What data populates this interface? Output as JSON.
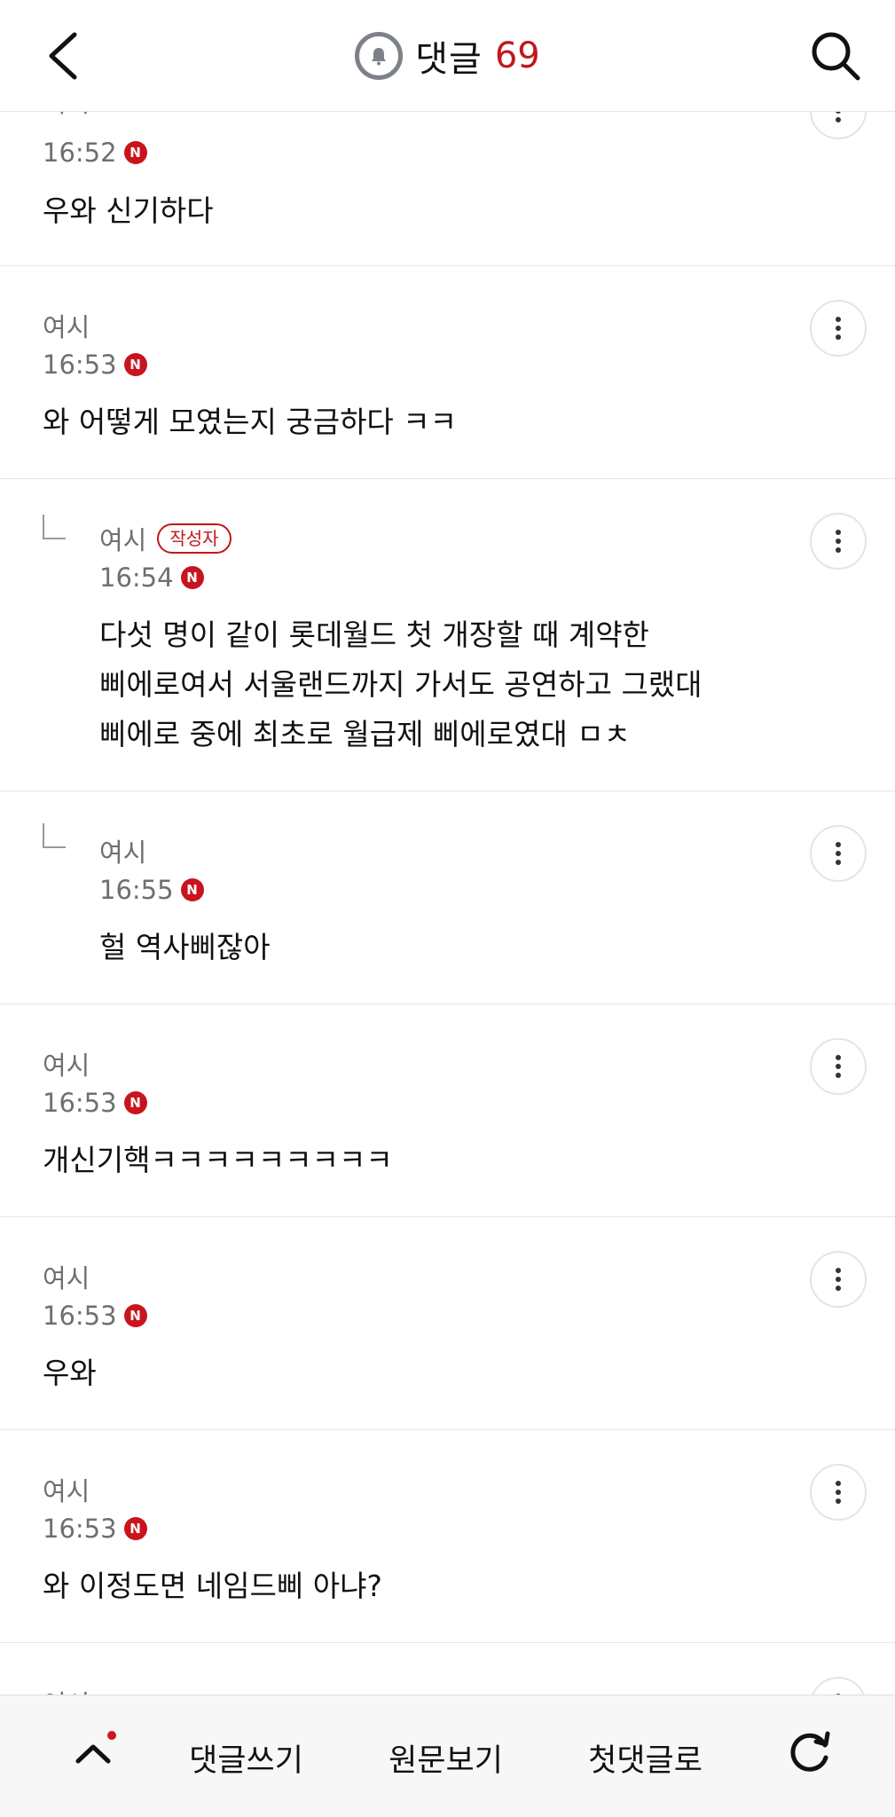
{
  "header": {
    "title": "댓글",
    "count": "69"
  },
  "comments": [
    {
      "author": "여시",
      "time": "16:52",
      "new_badge": "N",
      "text": [
        "우와 신기하다"
      ]
    },
    {
      "author": "여시",
      "time": "16:53",
      "new_badge": "N",
      "text": [
        "와 어떻게 모였는지 궁금하다 ㅋㅋ"
      ]
    },
    {
      "author": "여시",
      "op_badge": "작성자",
      "time": "16:54",
      "new_badge": "N",
      "reply": true,
      "text": [
        "다섯 명이 같이 롯데월드 첫 개장할 때 계약한",
        "삐에로여서 서울랜드까지 가서도 공연하고 그랬대",
        "삐에로 중에 최초로 월급제 삐에로였대 ㅁㅊ"
      ]
    },
    {
      "author": "여시",
      "time": "16:55",
      "new_badge": "N",
      "reply": true,
      "text": [
        "헐 역사삐잖아"
      ]
    },
    {
      "author": "여시",
      "time": "16:53",
      "new_badge": "N",
      "text": [
        "개신기핵ㅋㅋㅋㅋㅋㅋㅋㅋㅋ"
      ]
    },
    {
      "author": "여시",
      "time": "16:53",
      "new_badge": "N",
      "text": [
        "우와"
      ]
    },
    {
      "author": "여시",
      "time": "16:53",
      "new_badge": "N",
      "text": [
        "와 이정도면 네임드삐 아냐?"
      ]
    },
    {
      "author": "여시"
    }
  ],
  "bottom_bar": {
    "write_comment": "댓글쓰기",
    "view_original": "원문보기",
    "first_comment": "첫댓글로"
  },
  "colors": {
    "accent_red": "#c0181b",
    "meta_gray": "#6f6f73",
    "divider": "#e6e6e6"
  },
  "icons": [
    "back-arrow-icon",
    "bell-icon",
    "search-icon",
    "more-vertical-icon",
    "chevron-up-icon",
    "refresh-icon"
  ]
}
